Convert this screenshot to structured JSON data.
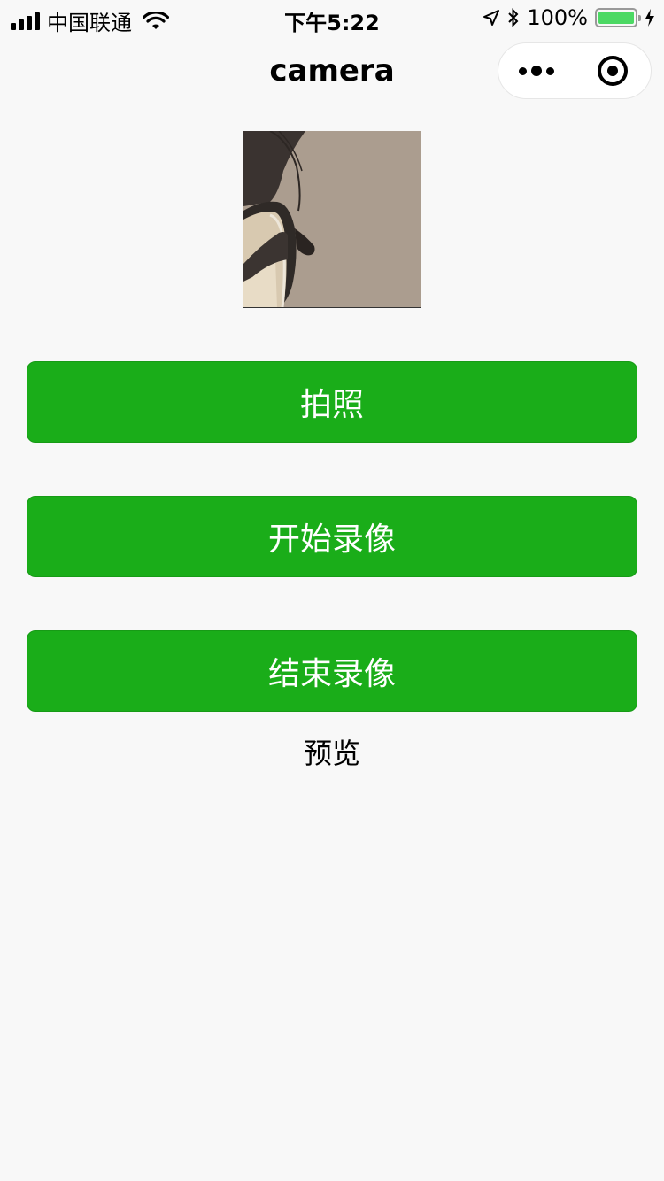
{
  "status_bar": {
    "carrier": "中国联通",
    "time": "下午5:22",
    "battery_percent": "100%",
    "battery_level": 1.0,
    "icons": [
      "signal-icon",
      "wifi-icon",
      "location-icon",
      "bluetooth-icon",
      "battery-icon",
      "charging-icon"
    ]
  },
  "nav": {
    "title": "camera",
    "capsule_icons": [
      "more-icon",
      "close-miniprogram-icon"
    ]
  },
  "camera": {
    "description_icon": "camera-preview"
  },
  "buttons": {
    "take_photo": "拍照",
    "start_record": "开始录像",
    "stop_record": "结束录像"
  },
  "preview_label": "预览",
  "colors": {
    "primary_button": "#1aad19",
    "background": "#f8f8f8",
    "battery": "#4cd964"
  }
}
